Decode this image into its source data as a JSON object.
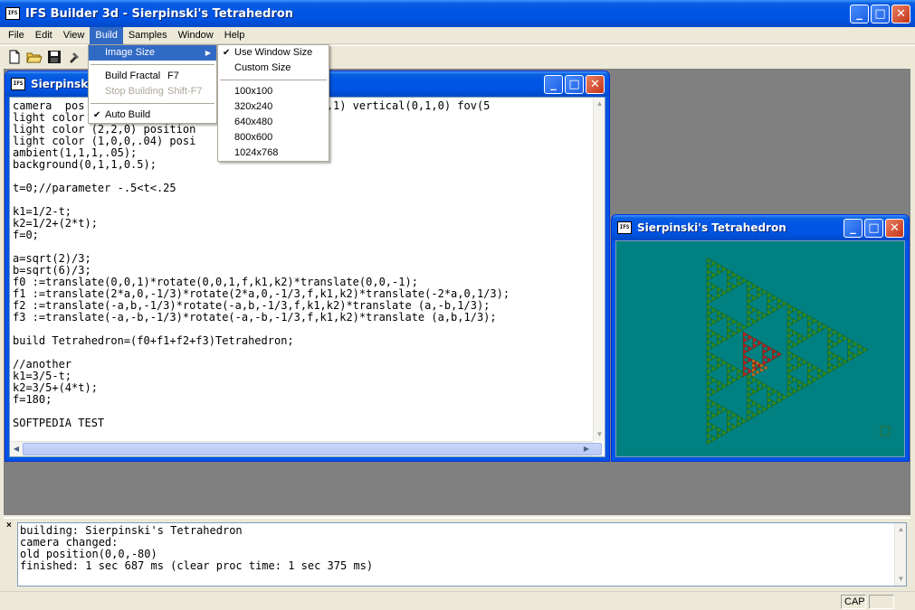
{
  "app": {
    "title": "IFS Builder 3d - Sierpinski's Tetrahedron",
    "icon_text": "IFS"
  },
  "menubar": [
    "File",
    "Edit",
    "View",
    "Build",
    "Samples",
    "Window",
    "Help"
  ],
  "menubar_active": "Build",
  "toolbar_icons": [
    "new-file-icon",
    "open-folder-icon",
    "save-disk-icon",
    "build-icon"
  ],
  "build_menu": {
    "items": [
      {
        "label": "Image Size",
        "shortcut": "",
        "checked": false,
        "disabled": false,
        "highlighted": true,
        "submenu": true
      },
      {
        "label": "Build Fractal",
        "shortcut": "F7",
        "checked": false,
        "disabled": false,
        "highlighted": false,
        "submenu": false
      },
      {
        "label": "Stop Building",
        "shortcut": "Shift-F7",
        "checked": false,
        "disabled": true,
        "highlighted": false,
        "submenu": false
      },
      {
        "label": "Auto Build",
        "shortcut": "",
        "checked": true,
        "disabled": false,
        "highlighted": false,
        "submenu": false
      }
    ]
  },
  "image_size_menu": {
    "items": [
      {
        "label": "Use Window Size",
        "checked": true
      },
      {
        "label": "Custom Size",
        "checked": false
      },
      {
        "label": "100x100",
        "checked": false
      },
      {
        "label": "320x240",
        "checked": false
      },
      {
        "label": "640x480",
        "checked": false
      },
      {
        "label": "800x600",
        "checked": false
      },
      {
        "label": "1024x768",
        "checked": false
      }
    ]
  },
  "editor": {
    "title": "Sierpinski's",
    "lines": [
      "camera  pos                          rection(0,0,1) vertical(0,1,0) fov(5",
      "light color                  ",
      "light color (2,2,0) position",
      "light color (1,0,0,.04) posi",
      "ambient(1,1,1,.05);",
      "background(0,1,1,0.5);",
      "",
      "t=0;//parameter -.5<t<.25",
      "",
      "k1=1/2-t;",
      "k2=1/2+(2*t);",
      "f=0;",
      "",
      "a=sqrt(2)/3;",
      "b=sqrt(6)/3;",
      "f0 :=translate(0,0,1)*rotate(0,0,1,f,k1,k2)*translate(0,0,-1);",
      "f1 :=translate(2*a,0,-1/3)*rotate(2*a,0,-1/3,f,k1,k2)*translate(-2*a,0,1/3);",
      "f2 :=translate(-a,b,-1/3)*rotate(-a,b,-1/3,f,k1,k2)*translate (a,-b,1/3);",
      "f3 :=translate(-a,-b,-1/3)*rotate(-a,-b,-1/3,f,k1,k2)*translate (a,b,1/3);",
      "",
      "build Tetrahedron=(f0+f1+f2+f3)Tetrahedron;",
      "",
      "//another",
      "k1=3/5-t;",
      "k2=3/5+(4*t);",
      "f=180;",
      "",
      "SOFTPEDIA TEST"
    ]
  },
  "render_window": {
    "title": "Sierpinski's Tetrahedron",
    "colors": {
      "background": "#008080",
      "fractal": "#2e8b1e",
      "accent_red": "#b22222",
      "accent_orange": "#d2691e"
    }
  },
  "log": {
    "lines": [
      "building: Sierpinski's Tetrahedron",
      "camera changed:",
      "old position(0,0,-80)",
      "finished: 1 sec 687 ms (clear proc time: 1 sec 375 ms)"
    ]
  },
  "status": {
    "cap": "CAP",
    "extra": ""
  }
}
